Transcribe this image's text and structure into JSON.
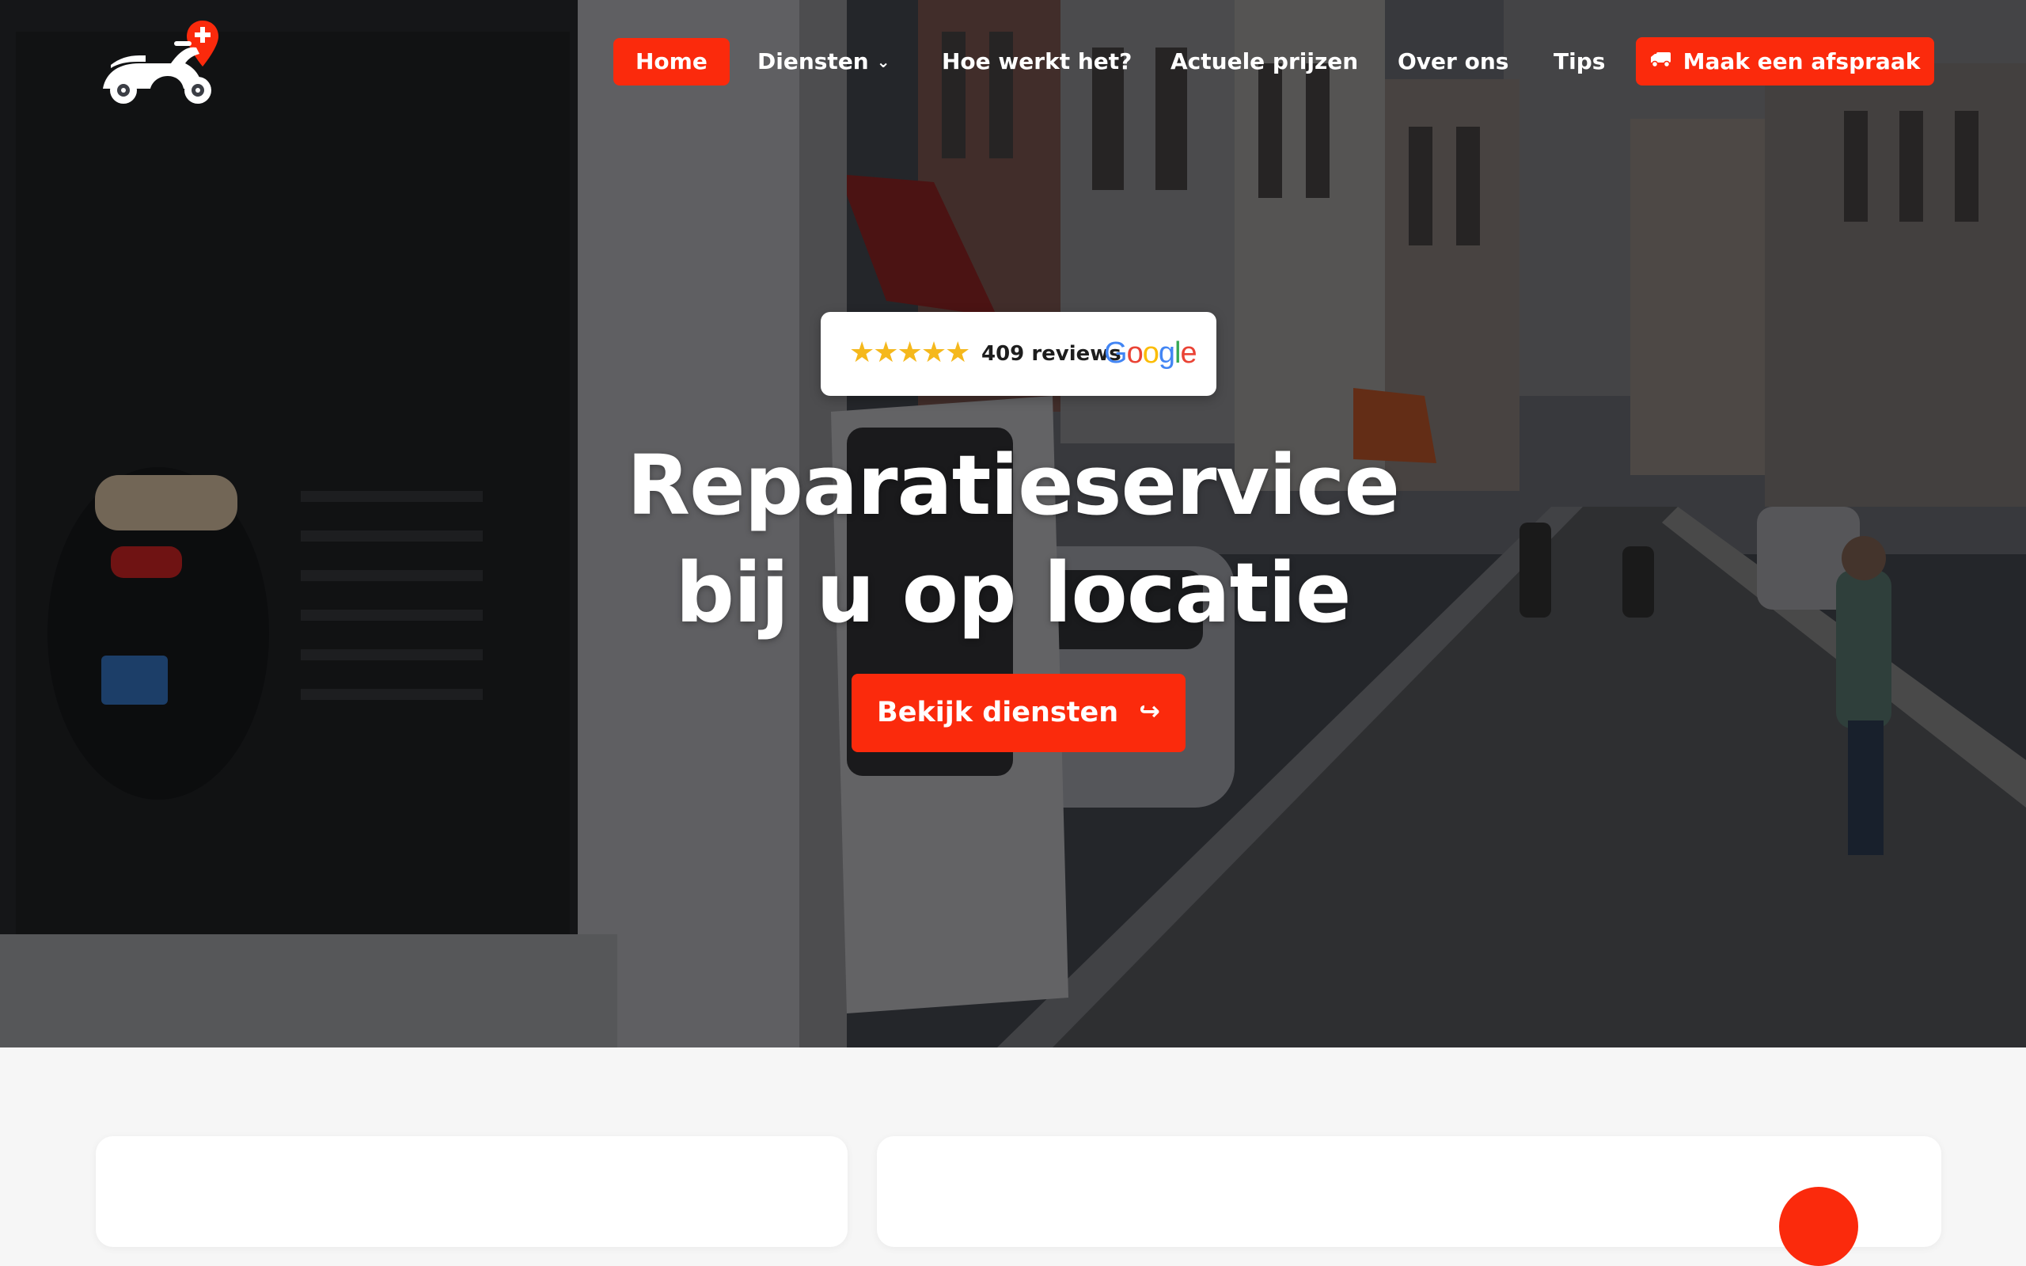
{
  "nav": {
    "logo_name": "scooter-logo",
    "items": [
      {
        "label": "Home",
        "active": true
      },
      {
        "label": "Diensten",
        "has_dropdown": true
      },
      {
        "label": "Hoe werkt het?"
      },
      {
        "label": "Actuele prijzen"
      },
      {
        "label": "Over ons"
      },
      {
        "label": "Tips"
      }
    ],
    "cta_label": "Maak een afspraak",
    "cta_icon": "truck-icon"
  },
  "hero": {
    "review": {
      "stars": "★★★★★",
      "rating": 5,
      "count_label": "409 reviews",
      "provider": "Google"
    },
    "headline_line1": "Reparatieservice",
    "headline_line2": "bij u op locatie",
    "cta_label": "Bekijk diensten",
    "cta_arrow": "↪"
  },
  "colors": {
    "accent": "#fb2a0c",
    "star": "#f5b81c",
    "page_bg": "#f6f6f6"
  }
}
